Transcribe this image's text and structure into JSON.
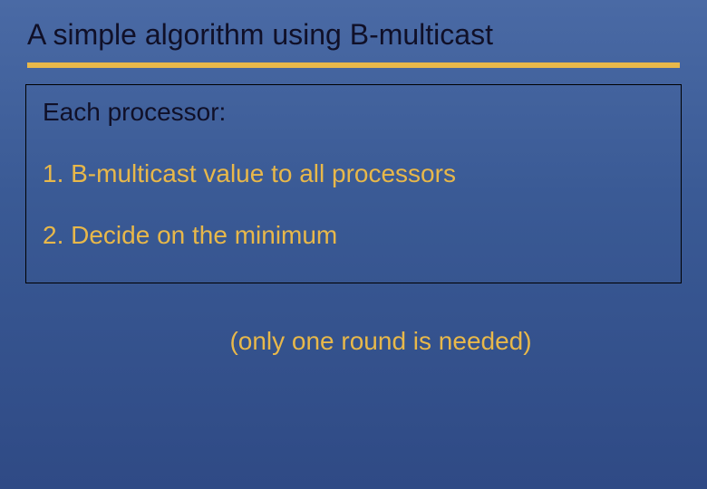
{
  "slide": {
    "title": "A simple algorithm using B-multicast",
    "intro": "Each processor:",
    "steps": [
      "1. B-multicast value to all processors",
      "2. Decide on the minimum"
    ],
    "note": "(only one round is needed)"
  }
}
